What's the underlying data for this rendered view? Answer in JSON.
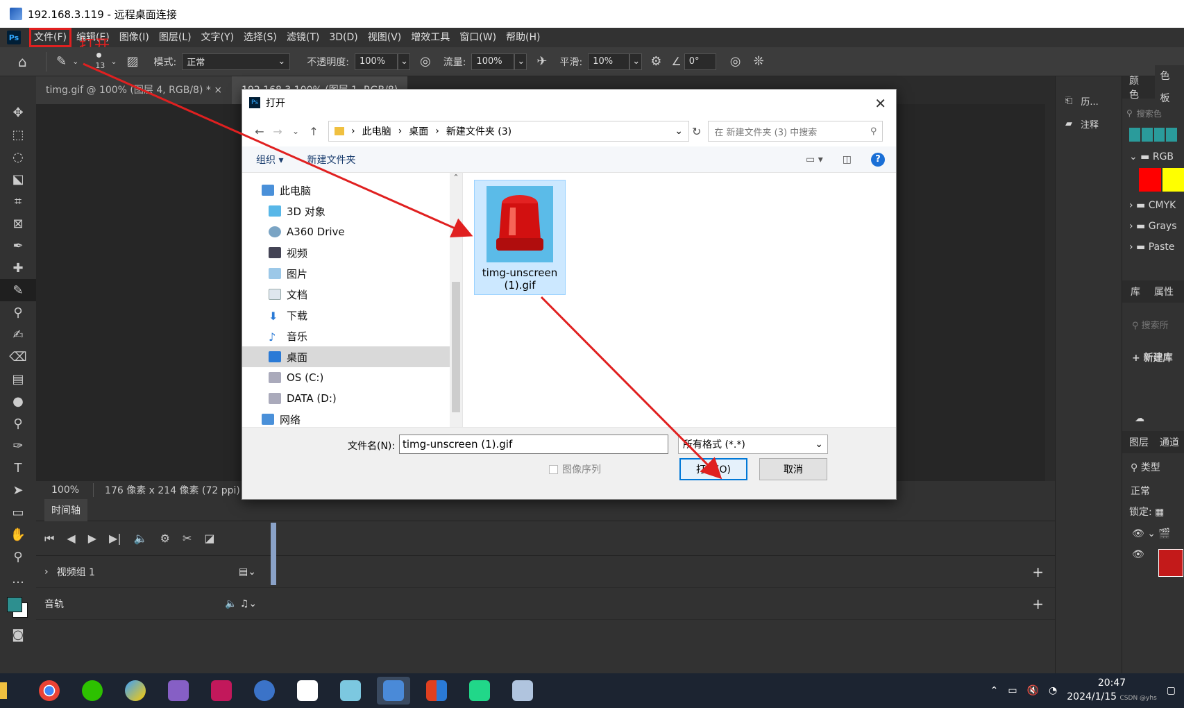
{
  "rdp": {
    "title": "192.168.3.119 - 远程桌面连接"
  },
  "menu": {
    "items": [
      "文件(F)",
      "编辑(E)",
      "图像(I)",
      "图层(L)",
      "文字(Y)",
      "选择(S)",
      "滤镜(T)",
      "3D(D)",
      "视图(V)",
      "增效工具",
      "窗口(W)",
      "帮助(H)"
    ],
    "annotation": "打开"
  },
  "options": {
    "brush_size": "13",
    "mode_label": "模式:",
    "mode_value": "正常",
    "opacity_label": "不透明度:",
    "opacity_value": "100%",
    "flow_label": "流量:",
    "flow_value": "100%",
    "smooth_label": "平滑:",
    "smooth_value": "10%",
    "angle_value": "0°"
  },
  "tabs": [
    "timg.gif @ 100% (图层 4, RGB/8) *",
    "192.168.3.100% (图层 1, RGB/8)"
  ],
  "status": {
    "zoom": "100%",
    "info": "176 像素 x 214 像素 (72 ppi)"
  },
  "timeline": {
    "title": "时间轴",
    "video_group": "视频组 1",
    "audio_track": "音轨"
  },
  "panel_mid": {
    "history": "历...",
    "notes": "注释"
  },
  "panel_right": {
    "tab_color": "颜色",
    "tab_swatches": "色板",
    "search_placeholder": "搜索色",
    "groups": [
      "RGB",
      "CMYK",
      "Grays",
      "Paste"
    ],
    "tab_lib": "库",
    "tab_props": "属性",
    "lib_search": "搜索所",
    "new_lib": "新建库",
    "tab_layers": "图层",
    "tab_channels": "通道",
    "filter_type": "类型",
    "blend": "正常",
    "lock": "锁定:"
  },
  "dialog": {
    "title": "打开",
    "breadcrumb": [
      "此电脑",
      "桌面",
      "新建文件夹 (3)"
    ],
    "search_placeholder": "在 新建文件夹 (3) 中搜索",
    "organize": "组织",
    "new_folder": "新建文件夹",
    "nav": [
      "此电脑",
      "3D 对象",
      "A360 Drive",
      "视频",
      "图片",
      "文档",
      "下载",
      "音乐",
      "桌面",
      "OS (C:)",
      "DATA (D:)",
      "网络"
    ],
    "file_name_line1": "timg-unscreen",
    "file_name_line2": "(1).gif",
    "filename_label": "文件名(N):",
    "filename_value": "timg-unscreen (1).gif",
    "filetype": "所有格式 (*.*)",
    "image_sequence": "图像序列",
    "open": "打开(O)",
    "cancel": "取消"
  },
  "tray": {
    "time": "20:47",
    "date": "2024/1/15",
    "watermark": "CSDN @yhs"
  },
  "colors": {
    "annotation_red": "#e02020",
    "ps_bg": "#323232",
    "selection": "#cce8ff"
  }
}
